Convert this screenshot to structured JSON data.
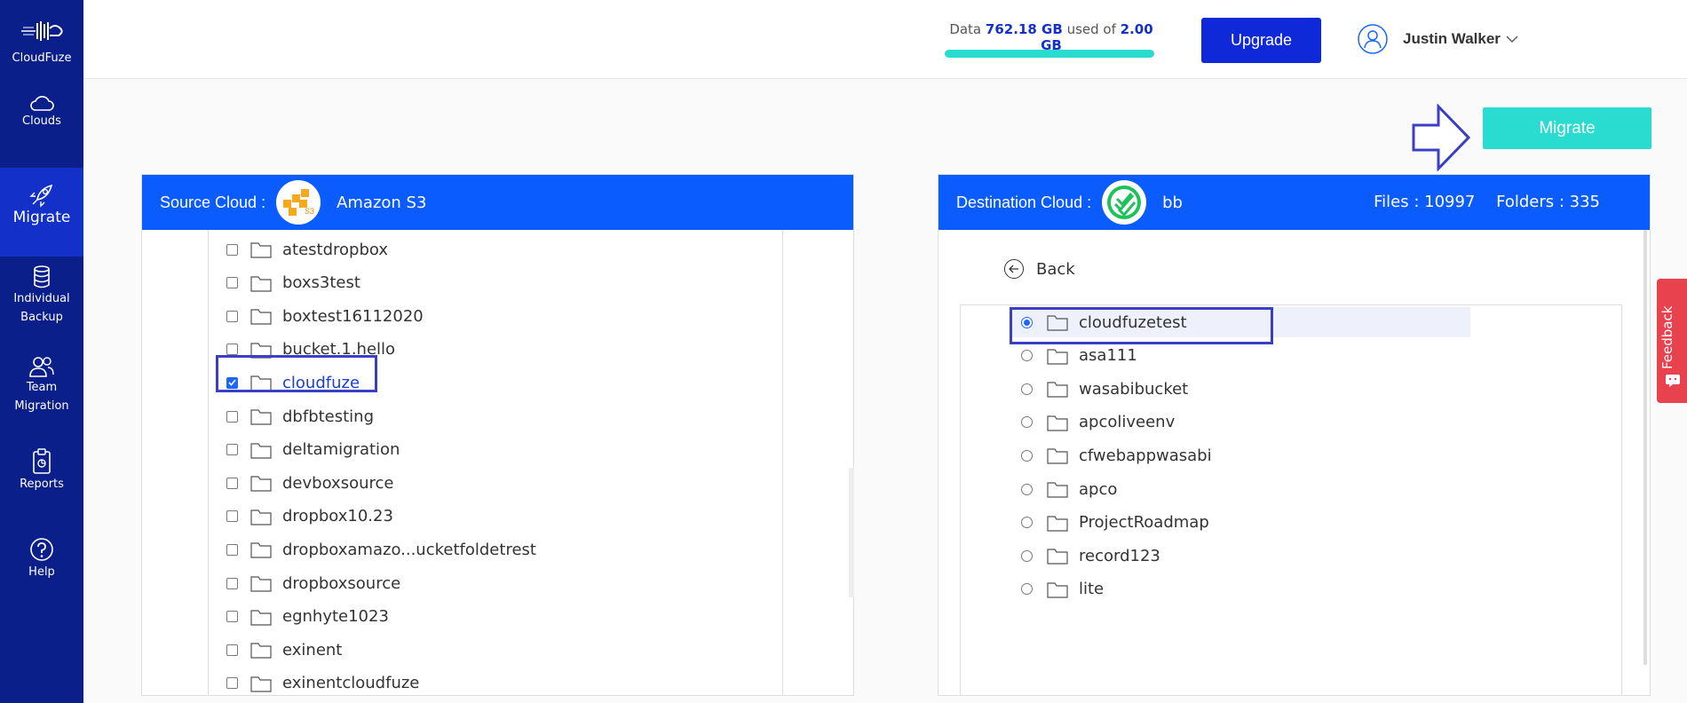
{
  "sidebar": {
    "brand": "CloudFuze",
    "items": [
      {
        "label": "Clouds",
        "icon": "cloud-icon"
      },
      {
        "label": "Migrate",
        "icon": "rocket-icon"
      },
      {
        "label": "Individual Backup",
        "icon": "database-icon"
      },
      {
        "label": "Team Migration",
        "icon": "users-icon"
      },
      {
        "label": "Reports",
        "icon": "clipboard-icon"
      },
      {
        "label": "Help",
        "icon": "help-icon"
      }
    ],
    "item_lines": {
      "clouds": "Clouds",
      "migrate": "Migrate",
      "backup_1": "Individual",
      "backup_2": "Backup",
      "team_1": "Team",
      "team_2": "Migration",
      "reports": "Reports",
      "help": "Help"
    }
  },
  "header": {
    "usage_prefix": "Data",
    "usage_used": "762.18 GB",
    "usage_mid": "used of",
    "usage_total": "2.00 GB",
    "upgrade_label": "Upgrade",
    "user_name": "Justin Walker"
  },
  "actions": {
    "migrate_label": "Migrate"
  },
  "source": {
    "title": "Source Cloud :",
    "cloud_name": "Amazon S3",
    "folders": [
      {
        "name": "atestdropbox",
        "checked": false
      },
      {
        "name": "boxs3test",
        "checked": false
      },
      {
        "name": "boxtest16112020",
        "checked": false
      },
      {
        "name": "bucket.1.hello",
        "checked": false
      },
      {
        "name": "cloudfuze",
        "checked": true
      },
      {
        "name": "dbfbtesting",
        "checked": false
      },
      {
        "name": "deltamigration",
        "checked": false
      },
      {
        "name": "devboxsource",
        "checked": false
      },
      {
        "name": "dropbox10.23",
        "checked": false
      },
      {
        "name": "dropboxamazo...ucketfoldetrest",
        "checked": false
      },
      {
        "name": "dropboxsource",
        "checked": false
      },
      {
        "name": "egnhyte1023",
        "checked": false
      },
      {
        "name": "exinent",
        "checked": false
      },
      {
        "name": "exinentcloudfuze",
        "checked": false
      }
    ]
  },
  "destination": {
    "title": "Destination Cloud :",
    "cloud_name": "bb",
    "files_label": "Files : 10997",
    "folders_label": "Folders : 335",
    "back_label": "Back",
    "folders": [
      {
        "name": "cloudfuzetest",
        "selected": true
      },
      {
        "name": "asa111",
        "selected": false
      },
      {
        "name": "wasabibucket",
        "selected": false
      },
      {
        "name": "apcoliveenv",
        "selected": false
      },
      {
        "name": "cfwebappwasabi",
        "selected": false
      },
      {
        "name": "apco",
        "selected": false
      },
      {
        "name": "ProjectRoadmap",
        "selected": false
      },
      {
        "name": "record123",
        "selected": false
      },
      {
        "name": "lite",
        "selected": false
      }
    ]
  },
  "feedback_label": "Feedback",
  "colors": {
    "sidebar": "#0a1f8a",
    "sidebar_active": "#1330c9",
    "panel_header": "#0b5cff",
    "accent_teal": "#2adccf",
    "upgrade": "#0f28d8",
    "highlight_box": "#3a3fc4",
    "feedback": "#e8424f"
  }
}
